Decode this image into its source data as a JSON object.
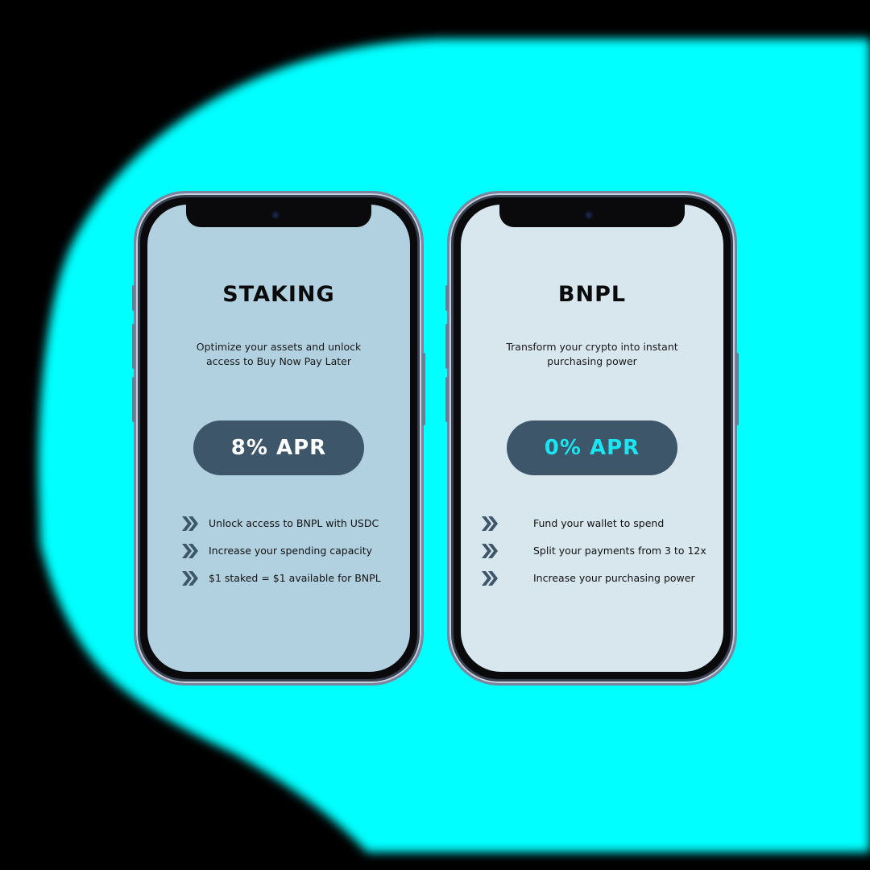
{
  "colors": {
    "background": "#000000",
    "glow": "#00ffff",
    "pill": "#3d5669",
    "chevron": "#3d5669",
    "staking_screen": "#b2d1e0",
    "bnpl_screen": "#d8e6ee"
  },
  "phones": [
    {
      "title": "STAKING",
      "description_line1": "Optimize your assets and unlock",
      "description_line2": "access to Buy Now Pay Later",
      "apr": "8% APR",
      "apr_color": "#ffffff",
      "screen_color": "#b2d1e0",
      "features": [
        {
          "icon": "double-chevron-right-icon",
          "text": "Unlock access to BNPL with USDC"
        },
        {
          "icon": "double-chevron-right-icon",
          "text": "Increase your spending capacity"
        },
        {
          "icon": "double-chevron-right-icon",
          "text": "$1 staked = $1 available for BNPL"
        }
      ]
    },
    {
      "title": "BNPL",
      "description_line1": "Transform your crypto into instant",
      "description_line2": "purchasing power",
      "apr": "0% APR",
      "apr_color": "#19e6f2",
      "screen_color": "#d8e6ee",
      "features": [
        {
          "icon": "double-chevron-right-icon",
          "text": "Fund your wallet to spend"
        },
        {
          "icon": "double-chevron-right-icon",
          "text": "Split your payments from 3 to 12x"
        },
        {
          "icon": "double-chevron-right-icon",
          "text": "Increase your purchasing power"
        }
      ]
    }
  ]
}
